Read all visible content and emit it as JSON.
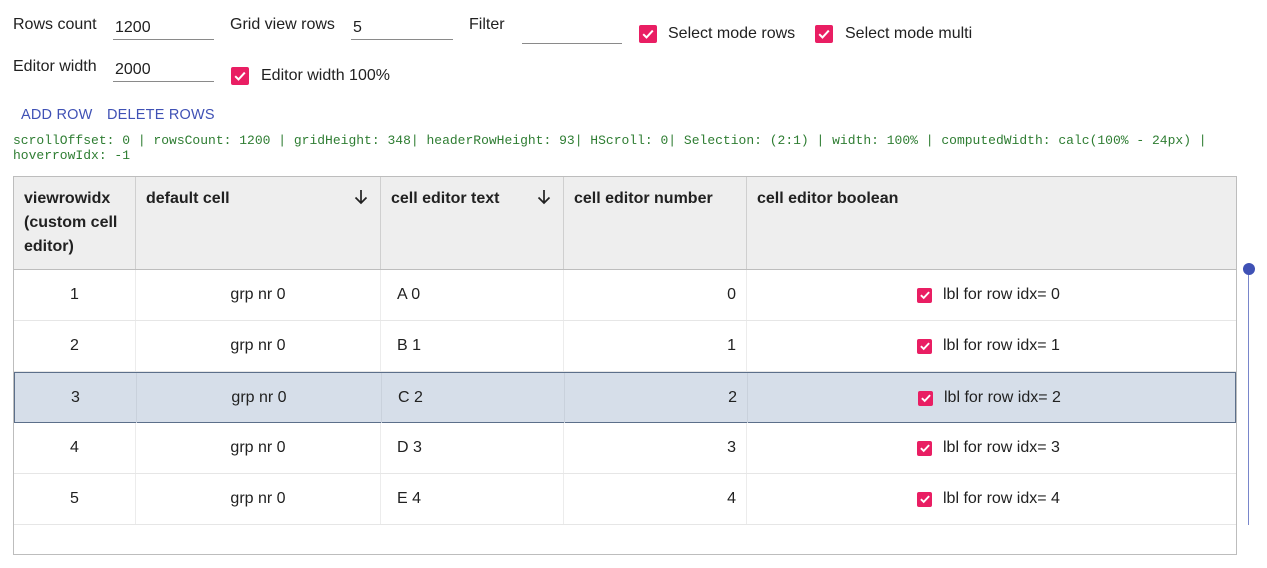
{
  "controls": {
    "rows_count": {
      "label": "Rows count",
      "value": "1200"
    },
    "grid_view_rows": {
      "label": "Grid view rows",
      "value": "5"
    },
    "filter": {
      "label": "Filter",
      "value": ""
    },
    "select_mode_rows": {
      "label": "Select mode rows",
      "checked": true
    },
    "select_mode_multi": {
      "label": "Select mode multi",
      "checked": true
    },
    "editor_width": {
      "label": "Editor width",
      "value": "2000"
    },
    "editor_width_100": {
      "label": "Editor width 100%",
      "checked": true
    }
  },
  "actions": {
    "add_row": "ADD ROW",
    "delete_rows": "DELETE ROWS"
  },
  "status": {
    "line1": "scrollOffset: 0 | rowsCount: 1200 | gridHeight: 348| headerRowHeight: 93| HScroll: 0| Selection: (2:1) | width: 100% | computedWidth: calc(100% - 24px) |",
    "line2": "hoverrowIdx: -1"
  },
  "grid": {
    "columns": [
      {
        "label": "viewrowidx (custom cell editor)",
        "sortable": false
      },
      {
        "label": "default cell",
        "sortable": true
      },
      {
        "label": "cell editor text",
        "sortable": true
      },
      {
        "label": "cell editor number",
        "sortable": false
      },
      {
        "label": "cell editor boolean",
        "sortable": false
      }
    ],
    "selected_row_index": 2,
    "rows": [
      {
        "idx": "1",
        "group": "grp nr 0",
        "text": "A 0",
        "number": "0",
        "bool_label": "lbl for row idx= 0",
        "checked": true
      },
      {
        "idx": "2",
        "group": "grp nr 0",
        "text": "B 1",
        "number": "1",
        "bool_label": "lbl for row idx= 1",
        "checked": true
      },
      {
        "idx": "3",
        "group": "grp nr 0",
        "text": "C 2",
        "number": "2",
        "bool_label": "lbl for row idx= 2",
        "checked": true
      },
      {
        "idx": "4",
        "group": "grp nr 0",
        "text": "D 3",
        "number": "3",
        "bool_label": "lbl for row idx= 3",
        "checked": true
      },
      {
        "idx": "5",
        "group": "grp nr 0",
        "text": "E 4",
        "number": "4",
        "bool_label": "lbl for row idx= 4",
        "checked": true
      }
    ]
  },
  "colors": {
    "accent": "#e91e63",
    "primary": "#3f51b5",
    "info_text": "#2e7d32",
    "selected_row": "#d6dee9"
  },
  "scrollbar": {
    "position": 0
  }
}
